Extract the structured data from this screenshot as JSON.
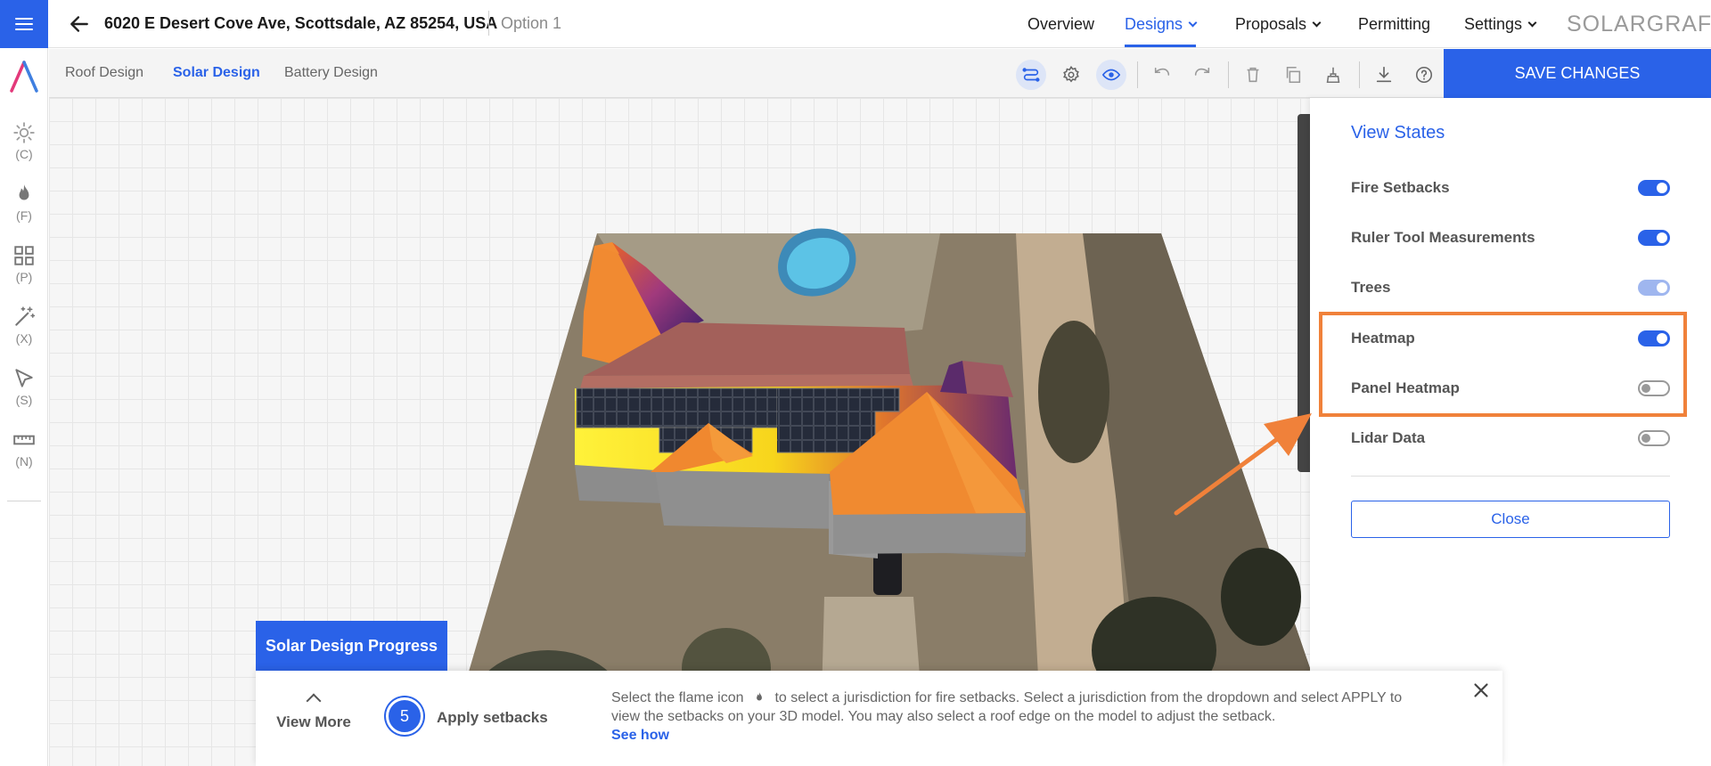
{
  "header": {
    "address": "6020 E Desert Cove Ave, Scottsdale, AZ 85254, USA",
    "option": "Option 1",
    "nav": [
      {
        "label": "Overview",
        "dropdown": false,
        "active": false
      },
      {
        "label": "Designs",
        "dropdown": true,
        "active": true
      },
      {
        "label": "Proposals",
        "dropdown": true,
        "active": false
      },
      {
        "label": "Permitting",
        "dropdown": false,
        "active": false
      },
      {
        "label": "Settings",
        "dropdown": true,
        "active": false
      }
    ],
    "logo": "SOLARGRAF"
  },
  "left_tools": [
    {
      "icon": "sun-icon",
      "key": "(C)"
    },
    {
      "icon": "flame-icon",
      "key": "(F)"
    },
    {
      "icon": "grid-icon",
      "key": "(P)"
    },
    {
      "icon": "magic-wand-icon",
      "key": "(X)"
    },
    {
      "icon": "cursor-arrow-icon",
      "key": "(S)"
    },
    {
      "icon": "ruler-icon",
      "key": "(N)"
    }
  ],
  "subtabs": [
    {
      "label": "Roof Design",
      "active": false
    },
    {
      "label": "Solar Design",
      "active": true
    },
    {
      "label": "Battery Design",
      "active": false
    }
  ],
  "toolbar_icons": [
    "route-icon",
    "gear-icon",
    "eye-icon",
    "undo-icon",
    "redo-icon",
    "trash-icon",
    "copy-icon",
    "brush-icon",
    "download-icon",
    "help-icon"
  ],
  "save_label": "SAVE CHANGES",
  "view_states": {
    "title": "View States",
    "items": [
      {
        "label": "Fire Setbacks",
        "state": "on"
      },
      {
        "label": "Ruler Tool Measurements",
        "state": "on"
      },
      {
        "label": "Trees",
        "state": "disabled-on"
      },
      {
        "label": "Heatmap",
        "state": "on"
      },
      {
        "label": "Panel Heatmap",
        "state": "off"
      },
      {
        "label": "Lidar Data",
        "state": "off"
      }
    ],
    "close_label": "Close"
  },
  "progress": {
    "tab_label": "Solar Design Progress",
    "view_more": "View More",
    "step_number": "5",
    "step_label": "Apply setbacks",
    "text_before_icon": "Select the flame icon",
    "text_after_icon": "to select a jurisdiction for fire setbacks. Select a jurisdiction from the dropdown and select APPLY to view the setbacks on your 3D model. You may also select a roof edge on the model to adjust the setback.",
    "see_how": "See how"
  },
  "colors": {
    "accent": "#2a62e8",
    "annotation": "#f0813a"
  }
}
